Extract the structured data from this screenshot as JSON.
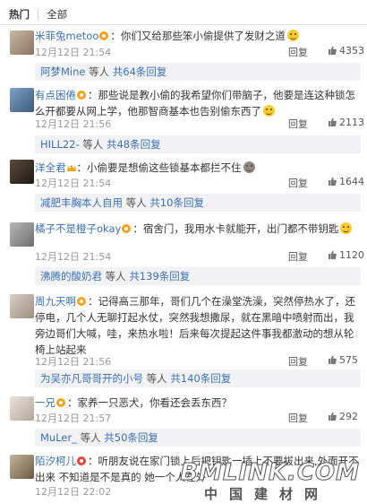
{
  "tabs": {
    "hot": "热门",
    "sep": "|",
    "all": "全部"
  },
  "reply_label": "回复",
  "comments": [
    {
      "user": "米菲兔metoo",
      "text": "你们又给那些笨小偷提供了发财之道",
      "time": "12月12日 21:54",
      "likes": "4353",
      "sub": {
        "user": "阿梦Mine",
        "mid": " 等人 ",
        "count": "共64条回复"
      }
    },
    {
      "user": "有点困倦",
      "text": "那些说是教小偷的我希望你们带脑子，他要是连这种锁怎么开都要从网上学，他那智商基本也告别偷东西了",
      "time": "12月12日 21:56",
      "likes": "2113",
      "sub": {
        "user": "HILL22-",
        "mid": " 等人 ",
        "count": "共48条回复"
      }
    },
    {
      "user": "洋全君",
      "text": "小偷要是想偷这些锁基本都拦不住",
      "time": "12月12日 21:54",
      "likes": "1644",
      "sub": {
        "user": "减肥丰胸本人自用",
        "mid": " 等人 ",
        "count": "共10条回复"
      }
    },
    {
      "user": "橘子不是橙子okay",
      "text": "宿舍门，我用水卡就能开，出门都不带钥匙",
      "time": "12月12日 21:54",
      "likes": "1120",
      "sub": {
        "user": "沸腾的酸奶君",
        "mid": " 等人 ",
        "count": "共139条回复"
      }
    },
    {
      "user": "周九天啊",
      "text": "记得高三那年，哥们几个在澡堂洗澡，突然停热水了，还停电，几个人无聊打起水仗，突然我想撒尿，就在黑暗中喷射而出，我旁边哥们大喊，哇，来热水啦！后来每次提起这件事我都激动的想从轮椅上站起来",
      "time": "12月12日 21:56",
      "likes": "575",
      "sub": {
        "user": "为吴亦凡哥哥开的小号",
        "mid": " 等人 ",
        "count": "共140条回复"
      }
    },
    {
      "user": "一兄",
      "text": "家养一只恶犬，你看还会丢东西？",
      "time": "12月12日 21:57",
      "likes": "292",
      "sub": {
        "user": "MuLer_",
        "mid": " 等人 ",
        "count": "共50条回复"
      }
    },
    {
      "user": "陌汐柯儿",
      "text": "听朋友说在家门锁上后把钥匙一插上不要拔出来,外面开不出来 不知道是不是真的 她一个人在外",
      "time": "12月12日 22:02",
      "likes": ""
    }
  ],
  "watermark": {
    "logo": "BMLINK.COM",
    "cn": "中国建材网"
  },
  "colors": {
    "link": "#3a71b1",
    "subbg": "#f2f2f5",
    "vip": "#f2a21a"
  }
}
